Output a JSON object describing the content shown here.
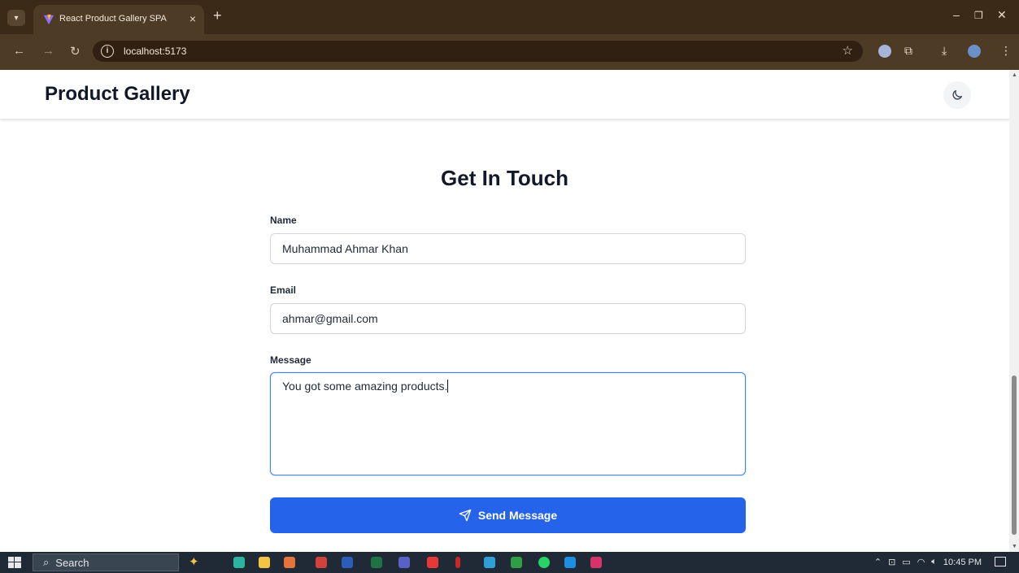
{
  "browser": {
    "tab_title": "React Product Gallery SPA",
    "url": "localhost:5173"
  },
  "site": {
    "brand": "Product Gallery"
  },
  "contact": {
    "title": "Get In Touch",
    "name_label": "Name",
    "name_value": "Muhammad Ahmar Khan",
    "email_label": "Email",
    "email_value": "ahmar@gmail.com",
    "message_label": "Message",
    "message_value": "You got some amazing products.",
    "send_label": "Send Message"
  },
  "taskbar": {
    "search_label": "Search",
    "time": "10:45 PM"
  },
  "colors": {
    "primary_button": "#2563eb",
    "focus_border": "#3b82f6",
    "chrome_bg": "#3b2a18"
  }
}
